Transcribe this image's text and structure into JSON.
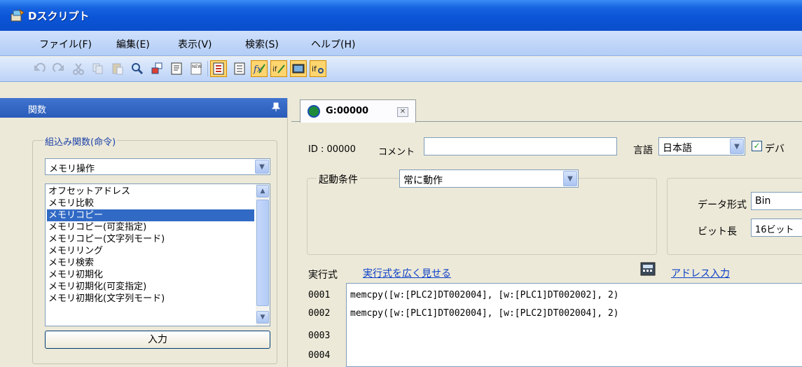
{
  "window": {
    "title": "Dスクリプト"
  },
  "menu": [
    "ファイル(F)",
    "編集(E)",
    "表示(V)",
    "検索(S)",
    "ヘルプ(H)"
  ],
  "toolbar": {
    "icons": [
      "undo-icon",
      "redo-icon",
      "cut-icon",
      "copy-icon",
      "paste-icon",
      "find-icon",
      "replace-icon",
      "properties-icon",
      "new-icon",
      "script-icon",
      "list-icon",
      "function-icon",
      "condition-icon",
      "image-icon",
      "if-icon"
    ]
  },
  "left_panel": {
    "title": "関数",
    "pin": "ᵖ",
    "group_label": "組込み関数(命令)",
    "category": "メモリ操作",
    "functions": [
      "オフセットアドレス",
      "メモリ比較",
      "メモリコピー",
      "メモリコピー(可変指定)",
      "メモリコピー(文字列モード)",
      "メモリリング",
      "メモリ検索",
      "メモリ初期化",
      "メモリ初期化(可変指定)",
      "メモリ初期化(文字列モード)"
    ],
    "selected_function": "メモリコピー",
    "input_button": "入力"
  },
  "tab": {
    "label": "G:00000"
  },
  "script": {
    "id_label": "ID : 00000",
    "comment_label": "コメント",
    "comment_value": "",
    "language_label": "言語",
    "language_value": "日本語",
    "debug_label": "デバ",
    "debug_checked": true,
    "trigger_label": "起動条件",
    "trigger_value": "常に動作",
    "data_format_label": "データ形式",
    "data_format_value": "Bin",
    "bit_length_label": "ビット長",
    "bit_length_value": "16ビット",
    "expression_label": "実行式",
    "expand_link": "実行式を広く見せる",
    "address_link": "アドレス入力"
  },
  "code": {
    "line_numbers": [
      "0001",
      "0002",
      "0003",
      "0004"
    ],
    "lines": [
      "memcpy([w:[PLC2]DT002004], [w:[PLC1]DT002002], 2)",
      "memcpy([w:[PLC1]DT002004], [w:[PLC2]DT002004], 2)",
      "",
      ""
    ]
  }
}
